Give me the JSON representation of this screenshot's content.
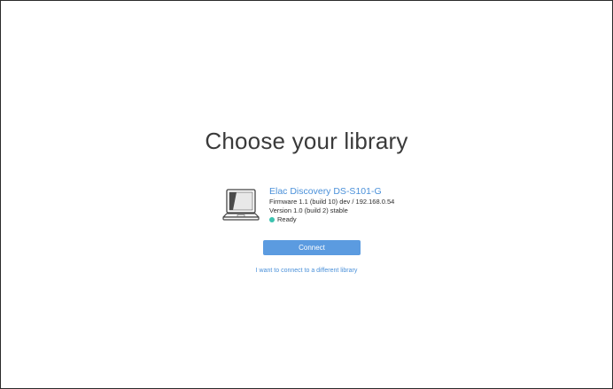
{
  "page": {
    "title": "Choose your library"
  },
  "device": {
    "icon": "laptop-icon",
    "name": "Elac Discovery DS-S101-G",
    "firmware": "Firmware 1.1 (build 10) dev / 192.168.0.54",
    "version": "Version 1.0 (build 2) stable",
    "status": "Ready",
    "status_icon": "status-dot-icon"
  },
  "actions": {
    "connect_label": "Connect",
    "alt_link_label": "I want to connect to a different library"
  },
  "colors": {
    "accent": "#4a90d9",
    "button": "#5b9be0",
    "status_ready": "#3cc3b0",
    "text": "#2d2d2d",
    "title": "#3a3a3a",
    "border": "#2b2b2b"
  }
}
